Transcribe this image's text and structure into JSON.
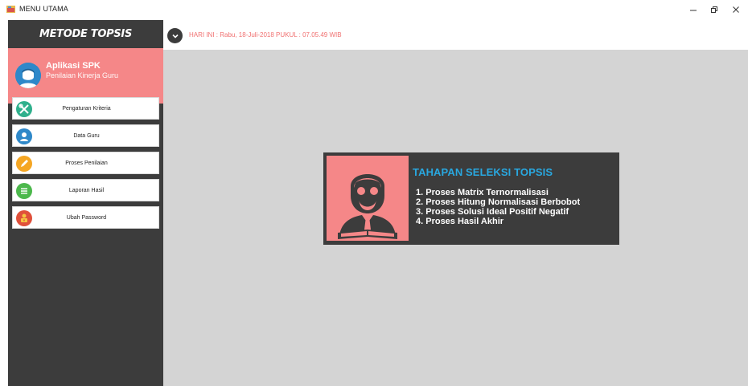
{
  "window": {
    "title": "MENU UTAMA",
    "controls": {
      "minimize": "–",
      "maximize": "❐",
      "close": "✕"
    }
  },
  "sidebar": {
    "header": "METODE TOPSIS",
    "profile": {
      "title": "Aplikasi SPK",
      "subtitle": "Penilaian Kinerja Guru"
    },
    "menu": [
      {
        "label": "Pengaturan Kriteria",
        "icon": "tools-icon",
        "color": "#2fb08c"
      },
      {
        "label": "Data Guru",
        "icon": "user-icon",
        "color": "#2e88c9"
      },
      {
        "label": "Proses Penilaian",
        "icon": "pencil-icon",
        "color": "#f5a623"
      },
      {
        "label": "Laporan Hasil",
        "icon": "list-icon",
        "color": "#4cb84c"
      },
      {
        "label": "Ubah Password",
        "icon": "lock-user-icon",
        "color": "#e0503a"
      }
    ]
  },
  "header": {
    "datetime": "HARI INI : Rabu, 18-Juli-2018 PUKUL : 07.05.49 WIB"
  },
  "info": {
    "title": "TAHAPAN SELEKSI TOPSIS",
    "steps": [
      "1. Proses Matrix Ternormalisasi",
      "2. Proses Hitung Normalisasi Berbobot",
      "3. Proses Solusi Ideal Positif  Negatif",
      "4. Proses Hasil Akhir"
    ]
  },
  "colors": {
    "sidebar_bg": "#3c3c3c",
    "accent_salmon": "#f58788",
    "main_bg": "#d4d4d4",
    "title_blue": "#29a8e0",
    "datetime_red": "#f07070"
  }
}
